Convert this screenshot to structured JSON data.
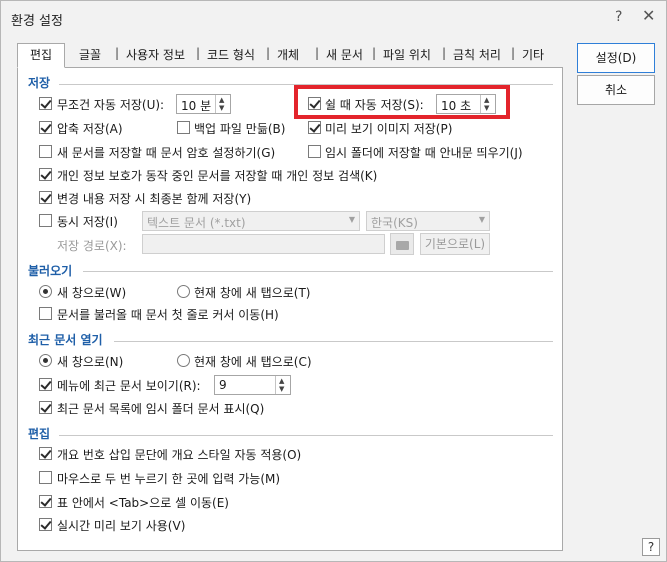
{
  "window": {
    "title": "환경 설정",
    "help_glyph": "?",
    "close_glyph": "✕"
  },
  "tabs": [
    {
      "label": "편집"
    },
    {
      "label": "글꼴"
    },
    {
      "label": "사용자 정보"
    },
    {
      "label": "코드 형식"
    },
    {
      "label": "개체"
    },
    {
      "label": "새 문서"
    },
    {
      "label": "파일 위치"
    },
    {
      "label": "금칙 처리"
    },
    {
      "label": "기타"
    }
  ],
  "buttons": {
    "ok": "설정(D)",
    "cancel": "취소",
    "browse_default": "기본으로(L)"
  },
  "sections": {
    "save": {
      "title": "저장",
      "unconditional_autosave": {
        "label": "무조건 자동 저장(U):",
        "checked": true,
        "value": "10 분"
      },
      "idle_autosave": {
        "label": "쉴 때 자동 저장(S):",
        "checked": true,
        "value": "10 초"
      },
      "compress_save": {
        "label": "압축 저장(A)",
        "checked": true
      },
      "backup_file": {
        "label": "백업 파일 만듦(B)",
        "checked": false
      },
      "preview_image": {
        "label": "미리 보기 이미지 저장(P)",
        "checked": true
      },
      "new_doc_password": {
        "label": "새 문서를 저장할 때 문서 암호 설정하기(G)",
        "checked": false
      },
      "temp_folder_notice": {
        "label": "임시 폴더에 저장할 때 안내문 띄우기(J)",
        "checked": false
      },
      "privacy_search": {
        "label": "개인 정보 보호가 동작 중인 문서를 저장할 때 개인 정보 검색(K)",
        "checked": true
      },
      "final_with_changes": {
        "label": "변경 내용 저장 시 최종본 함께 저장(Y)",
        "checked": true
      },
      "simultaneous_save": {
        "label": "동시 저장(I)",
        "checked": false
      },
      "format_select": "텍스트 문서 (*.txt)",
      "encoding_select": "한국(KS)",
      "save_path_label": "저장 경로(X):",
      "save_path_value": ""
    },
    "open": {
      "title": "불러오기",
      "new_window": {
        "label": "새 창으로(W)",
        "checked": true
      },
      "new_tab": {
        "label": "현재 창에 새 탭으로(T)",
        "checked": false
      },
      "move_cursor_first_line": {
        "label": "문서를 불러올 때 문서 첫 줄로 커서 이동(H)",
        "checked": false
      }
    },
    "recent": {
      "title": "최근 문서 열기",
      "new_window": {
        "label": "새 창으로(N)",
        "checked": true
      },
      "new_tab": {
        "label": "현재 창에 새 탭으로(C)",
        "checked": false
      },
      "show_in_menu": {
        "label": "메뉴에 최근 문서 보이기(R):",
        "checked": true,
        "value": "9"
      },
      "show_temp_folder": {
        "label": "최근 문서 목록에 임시 폴더 문서 표시(Q)",
        "checked": true
      }
    },
    "edit": {
      "title": "편집",
      "outline_style": {
        "label": "개요 번호 삽입 문단에 개요 스타일 자동 적용(O)",
        "checked": true
      },
      "double_click_input": {
        "label": "마우스로 두 번 누르기 한 곳에 입력 가능(M)",
        "checked": false
      },
      "tab_cell_move": {
        "label": "표 안에서 <Tab>으로 셀 이동(E)",
        "checked": true
      },
      "realtime_preview": {
        "label": "실시간 미리 보기 사용(V)",
        "checked": true
      }
    }
  },
  "colors": {
    "section_title": "#1f5fa8",
    "highlight_border": "#e3242b",
    "primary_button_border": "#2f7fd8"
  }
}
